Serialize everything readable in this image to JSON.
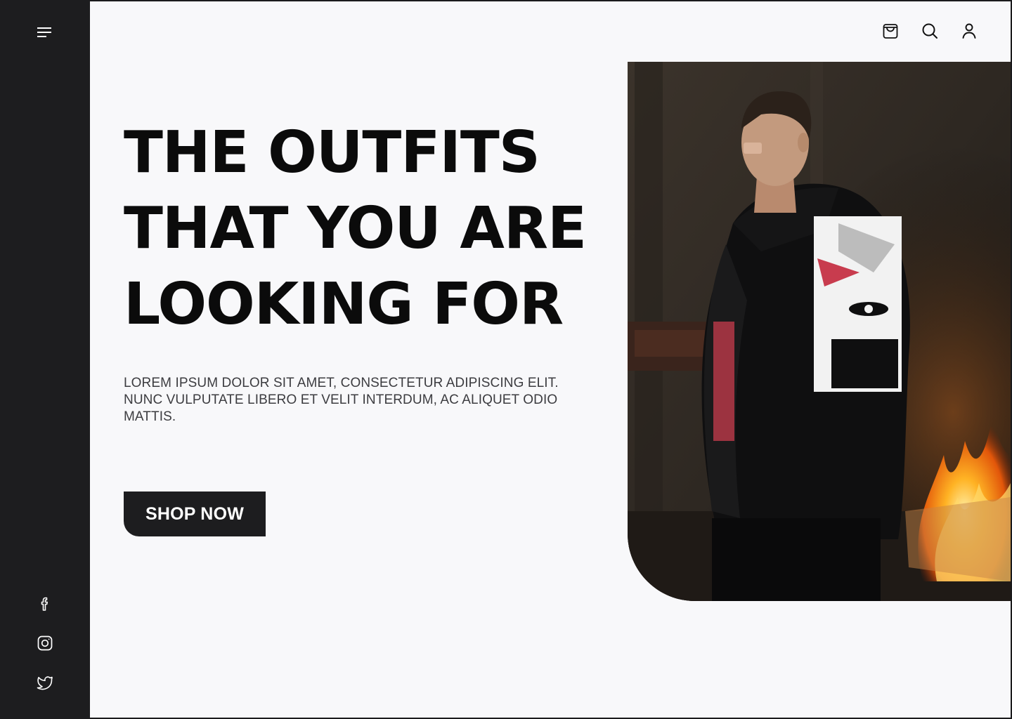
{
  "sidebar": {
    "menu_icon": "menu-icon",
    "social": [
      "facebook-icon",
      "instagram-icon",
      "twitter-icon"
    ]
  },
  "header": {
    "icons": [
      "shopping-bag-icon",
      "search-icon",
      "user-icon"
    ]
  },
  "hero": {
    "headline_lines": [
      "THE OUTFITS",
      "THAT YOU ARE",
      "LOOKING FOR"
    ],
    "description": "LOREM IPSUM DOLOR SIT AMET, CONSECTETUR ADIPISCING ELIT. NUNC VULPUTATE LIBERO ET VELIT INTERDUM, AC ALIQUET ODIO MATTIS.",
    "cta_label": "SHOP NOW",
    "image_subject": "Man in black graphic-print jacket beside a fire"
  },
  "colors": {
    "background": "#f8f8fa",
    "sidebar": "#1d1d1f",
    "text": "#0b0b0b",
    "button": "#1d1d1f",
    "button_text": "#ffffff"
  }
}
